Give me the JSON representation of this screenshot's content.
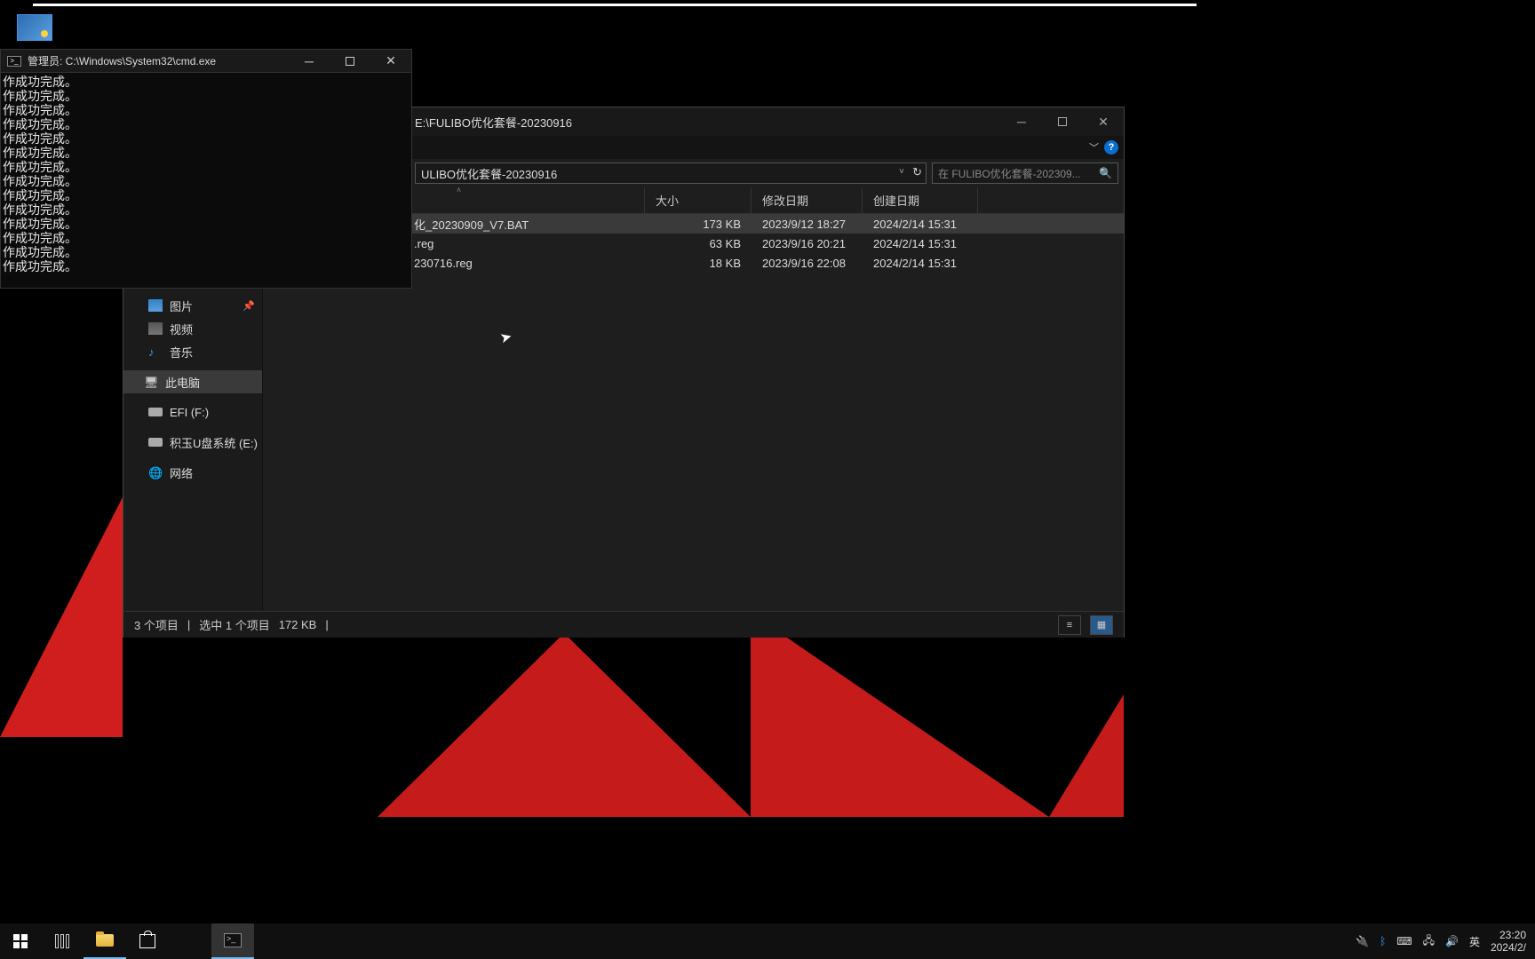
{
  "cmd": {
    "title": "管理员: C:\\Windows\\System32\\cmd.exe",
    "lines": [
      "作成功完成。",
      "作成功完成。",
      "作成功完成。",
      "作成功完成。",
      "作成功完成。",
      "作成功完成。",
      "作成功完成。",
      "作成功完成。",
      "作成功完成。",
      "作成功完成。",
      "作成功完成。",
      "作成功完成。",
      "作成功完成。",
      "作成功完成。"
    ]
  },
  "explorer": {
    "title_suffix": "E:\\FULIBO优化套餐-20230916",
    "address": "ULIBO优化套餐-20230916",
    "search_placeholder": "在 FULIBO优化套餐-202309...",
    "columns": {
      "size": "大小",
      "modified": "修改日期",
      "created": "创建日期"
    },
    "files": [
      {
        "name": "化_20230909_V7.BAT",
        "size": "173 KB",
        "modified": "2023/9/12 18:27",
        "created": "2024/2/14 15:31",
        "selected": true
      },
      {
        "name": ".reg",
        "size": "63 KB",
        "modified": "2023/9/16 20:21",
        "created": "2024/2/14 15:31",
        "selected": false
      },
      {
        "name": "230716.reg",
        "size": "18 KB",
        "modified": "2023/9/16 22:08",
        "created": "2024/2/14 15:31",
        "selected": false
      }
    ],
    "nav": {
      "pictures": "图片",
      "videos": "视频",
      "music": "音乐",
      "this_pc": "此电脑",
      "drive_f": "EFI (F:)",
      "drive_e": "积玉U盘系统 (E:)",
      "network": "网络"
    },
    "status": {
      "count": "3 个项目",
      "selected": "选中 1 个项目",
      "size": "172 KB"
    }
  },
  "tray": {
    "ime": "英",
    "time": "23:20",
    "date": "2024/2/"
  }
}
